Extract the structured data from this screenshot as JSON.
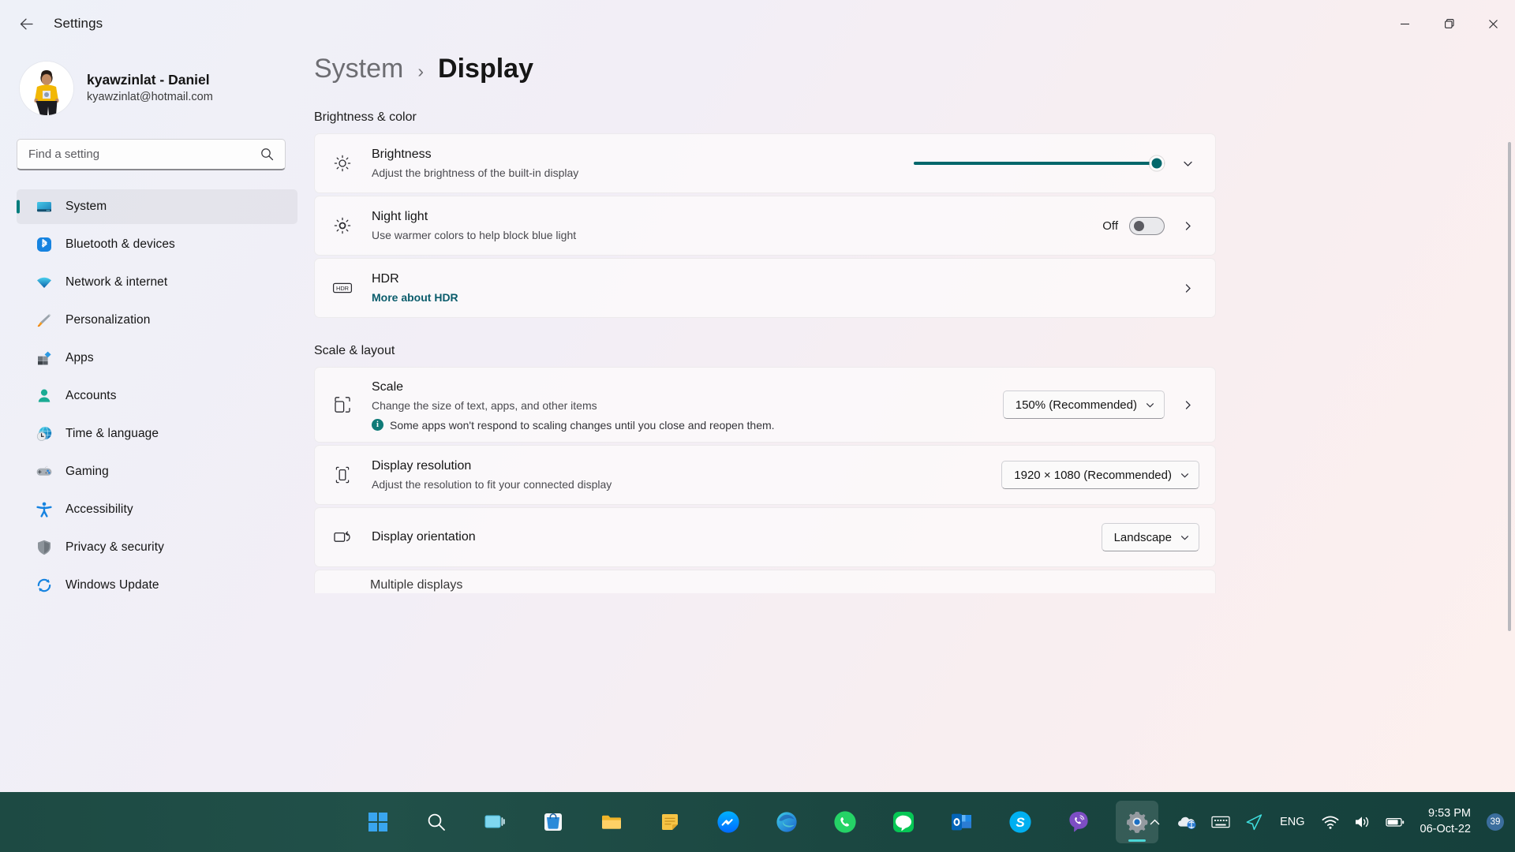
{
  "titlebar": {
    "back_label": "back-arrow",
    "title": "Settings",
    "minimize": "minimize",
    "maximize": "maximize",
    "close": "close"
  },
  "sidebar": {
    "profile": {
      "name": "kyawzinlat - Daniel",
      "email": "kyawzinlat@hotmail.com"
    },
    "search": {
      "placeholder": "Find a setting",
      "value": ""
    },
    "items": [
      {
        "label": "System",
        "icon": "monitor-icon",
        "active": true
      },
      {
        "label": "Bluetooth & devices",
        "icon": "bluetooth-icon",
        "active": false
      },
      {
        "label": "Network & internet",
        "icon": "wifi-icon",
        "active": false
      },
      {
        "label": "Personalization",
        "icon": "paintbrush-icon",
        "active": false
      },
      {
        "label": "Apps",
        "icon": "apps-icon",
        "active": false
      },
      {
        "label": "Accounts",
        "icon": "person-icon",
        "active": false
      },
      {
        "label": "Time & language",
        "icon": "clock-globe-icon",
        "active": false
      },
      {
        "label": "Gaming",
        "icon": "gamepad-icon",
        "active": false
      },
      {
        "label": "Accessibility",
        "icon": "accessibility-icon",
        "active": false
      },
      {
        "label": "Privacy & security",
        "icon": "shield-icon",
        "active": false
      },
      {
        "label": "Windows Update",
        "icon": "update-icon",
        "active": false
      }
    ]
  },
  "breadcrumb": {
    "parent": "System",
    "separator": "›",
    "current": "Display"
  },
  "sections": {
    "brightness_color": {
      "title": "Brightness & color",
      "brightness": {
        "title": "Brightness",
        "subtitle": "Adjust the brightness of the built-in display",
        "slider_value": 97,
        "icon": "brightness-sun-icon"
      },
      "night_light": {
        "title": "Night light",
        "subtitle": "Use warmer colors to help block blue light",
        "state_label": "Off",
        "toggle_on": false,
        "icon": "night-light-icon"
      },
      "hdr": {
        "title": "HDR",
        "link": "More about HDR",
        "icon": "hdr-icon"
      }
    },
    "scale_layout": {
      "title": "Scale & layout",
      "scale": {
        "title": "Scale",
        "subtitle": "Change the size of text, apps, and other items",
        "note": "Some apps won't respond to scaling changes until you close and reopen them.",
        "note_icon": "info-icon",
        "value": "150% (Recommended)",
        "icon": "scale-icon"
      },
      "resolution": {
        "title": "Display resolution",
        "subtitle": "Adjust the resolution to fit your connected display",
        "value": "1920 × 1080 (Recommended)",
        "icon": "resolution-icon"
      },
      "orientation": {
        "title": "Display orientation",
        "value": "Landscape",
        "icon": "orientation-icon"
      },
      "multiple_displays": {
        "title": "Multiple displays"
      }
    }
  },
  "taskbar": {
    "apps": [
      {
        "name": "start-button",
        "icon": "windows-logo"
      },
      {
        "name": "search-button",
        "icon": "search-icon"
      },
      {
        "name": "task-view-button",
        "icon": "task-view-icon"
      },
      {
        "name": "microsoft-store",
        "icon": "store-icon"
      },
      {
        "name": "file-explorer",
        "icon": "folder-icon"
      },
      {
        "name": "sticky-notes",
        "icon": "notes-icon"
      },
      {
        "name": "messenger",
        "icon": "messenger-icon"
      },
      {
        "name": "edge-browser",
        "icon": "edge-icon"
      },
      {
        "name": "whatsapp",
        "icon": "whatsapp-icon"
      },
      {
        "name": "line-app",
        "icon": "line-icon"
      },
      {
        "name": "outlook",
        "icon": "outlook-icon"
      },
      {
        "name": "skype",
        "icon": "skype-icon"
      },
      {
        "name": "viber",
        "icon": "viber-icon"
      },
      {
        "name": "settings-app",
        "icon": "gear-icon",
        "active": true
      }
    ],
    "tray": {
      "overflow": "chevron-up-icon",
      "onedrive": "onedrive-icon",
      "keyboard": "keyboard-icon",
      "send": "send-icon",
      "language": "ENG",
      "wifi": "wifi-icon",
      "volume": "volume-icon",
      "battery": "battery-icon"
    },
    "clock": {
      "time": "9:53 PM",
      "date": "06-Oct-22"
    },
    "notification_count": "39"
  },
  "colors": {
    "accent_teal": "#02676B",
    "sidebar_active_bar": "#017D7D",
    "link_teal": "#0a5c6b",
    "taskbar_green": "#1d4a43"
  }
}
